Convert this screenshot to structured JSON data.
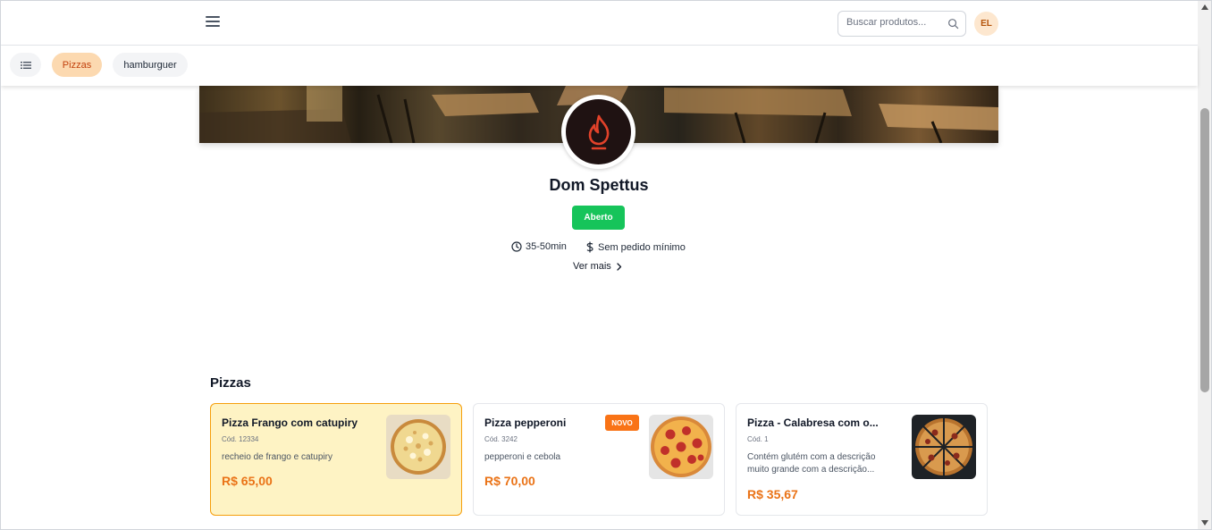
{
  "header": {
    "search_placeholder": "Buscar produtos...",
    "avatar_initials": "EL"
  },
  "categories": [
    {
      "label": "Pizzas",
      "active": true
    },
    {
      "label": "hamburguer",
      "active": false
    }
  ],
  "store": {
    "name": "Dom Spettus",
    "status": "Aberto",
    "delivery_time": "35-50min",
    "min_order": "Sem pedido mínimo",
    "more_label": "Ver mais"
  },
  "section": {
    "title": "Pizzas"
  },
  "products": [
    {
      "name": "Pizza Frango com catupiry",
      "code": "Cód. 12334",
      "description": "recheio de frango e catupiry",
      "price": "R$ 65,00",
      "badge": "",
      "selected": true,
      "image_icon": "pizza-chicken-image"
    },
    {
      "name": "Pizza pepperoni",
      "code": "Cód. 3242",
      "description": "pepperoni e cebola",
      "price": "R$ 70,00",
      "badge": "NOVO",
      "selected": false,
      "image_icon": "pizza-pepperoni-image"
    },
    {
      "name": "Pizza - Calabresa com o...",
      "code": "Cód. 1",
      "description": "Contém glutém com a descrição muito grande com a descrição...",
      "price": "R$ 35,67",
      "badge": "",
      "selected": false,
      "image_icon": "pizza-calabresa-image"
    }
  ],
  "colors": {
    "accent": "#ea7317",
    "open_status": "#16c45a",
    "selected_card_bg": "#fef3c4",
    "active_chip_bg": "#fcd9b0"
  }
}
